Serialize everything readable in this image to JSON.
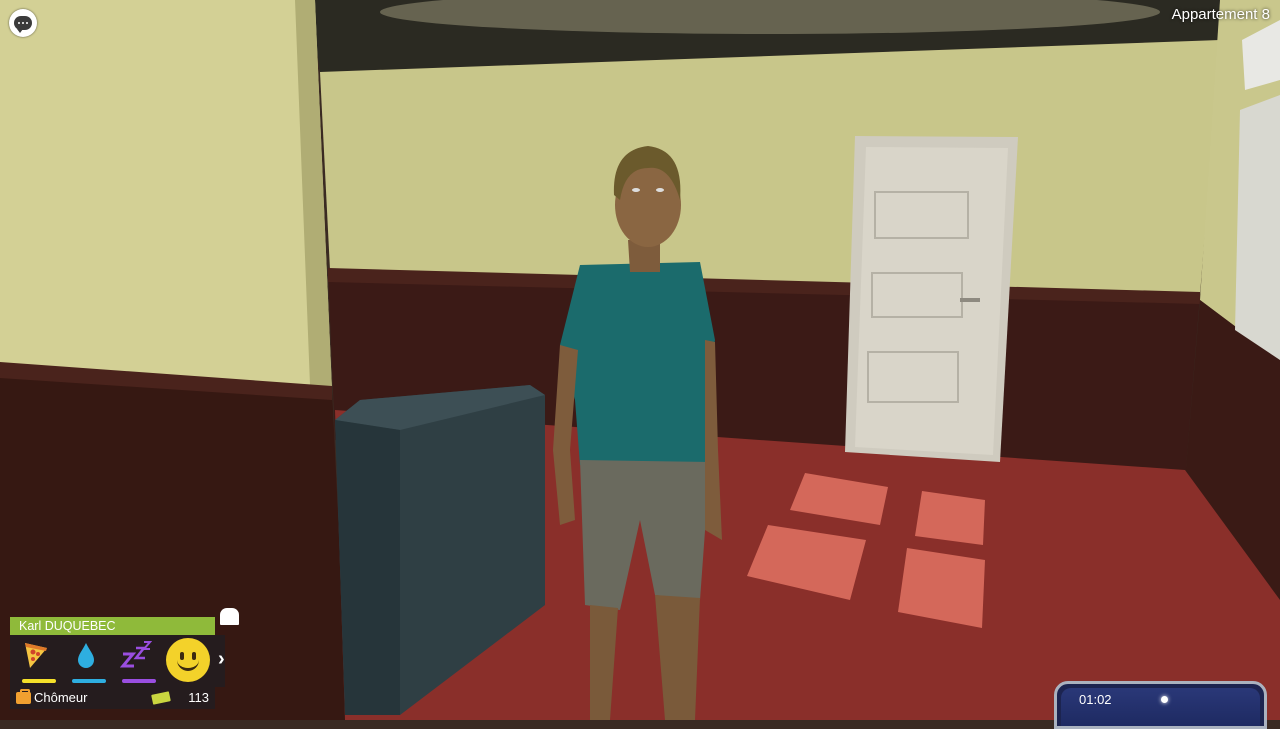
{
  "location": {
    "label": "Appartement 8"
  },
  "character": {
    "name": "Karl DUQUEBEC",
    "job": "Chômeur",
    "money": "113"
  },
  "needs": [
    {
      "name": "hunger",
      "icon": "pizza-icon",
      "color": "#f5e02a"
    },
    {
      "name": "thirst",
      "icon": "water-drop-icon",
      "color": "#2eaee0"
    },
    {
      "name": "sleep",
      "icon": "sleep-zzz-icon",
      "color": "#9a4ee0"
    }
  ],
  "mood": {
    "icon": "smiley-icon",
    "color": "#f3d22a"
  },
  "clock": {
    "time": "01:02"
  },
  "colors": {
    "name_bar": "#8fba3a",
    "floor": "#8a2f2a",
    "wall": "#c9c78c",
    "shirt": "#1b6b6c"
  }
}
